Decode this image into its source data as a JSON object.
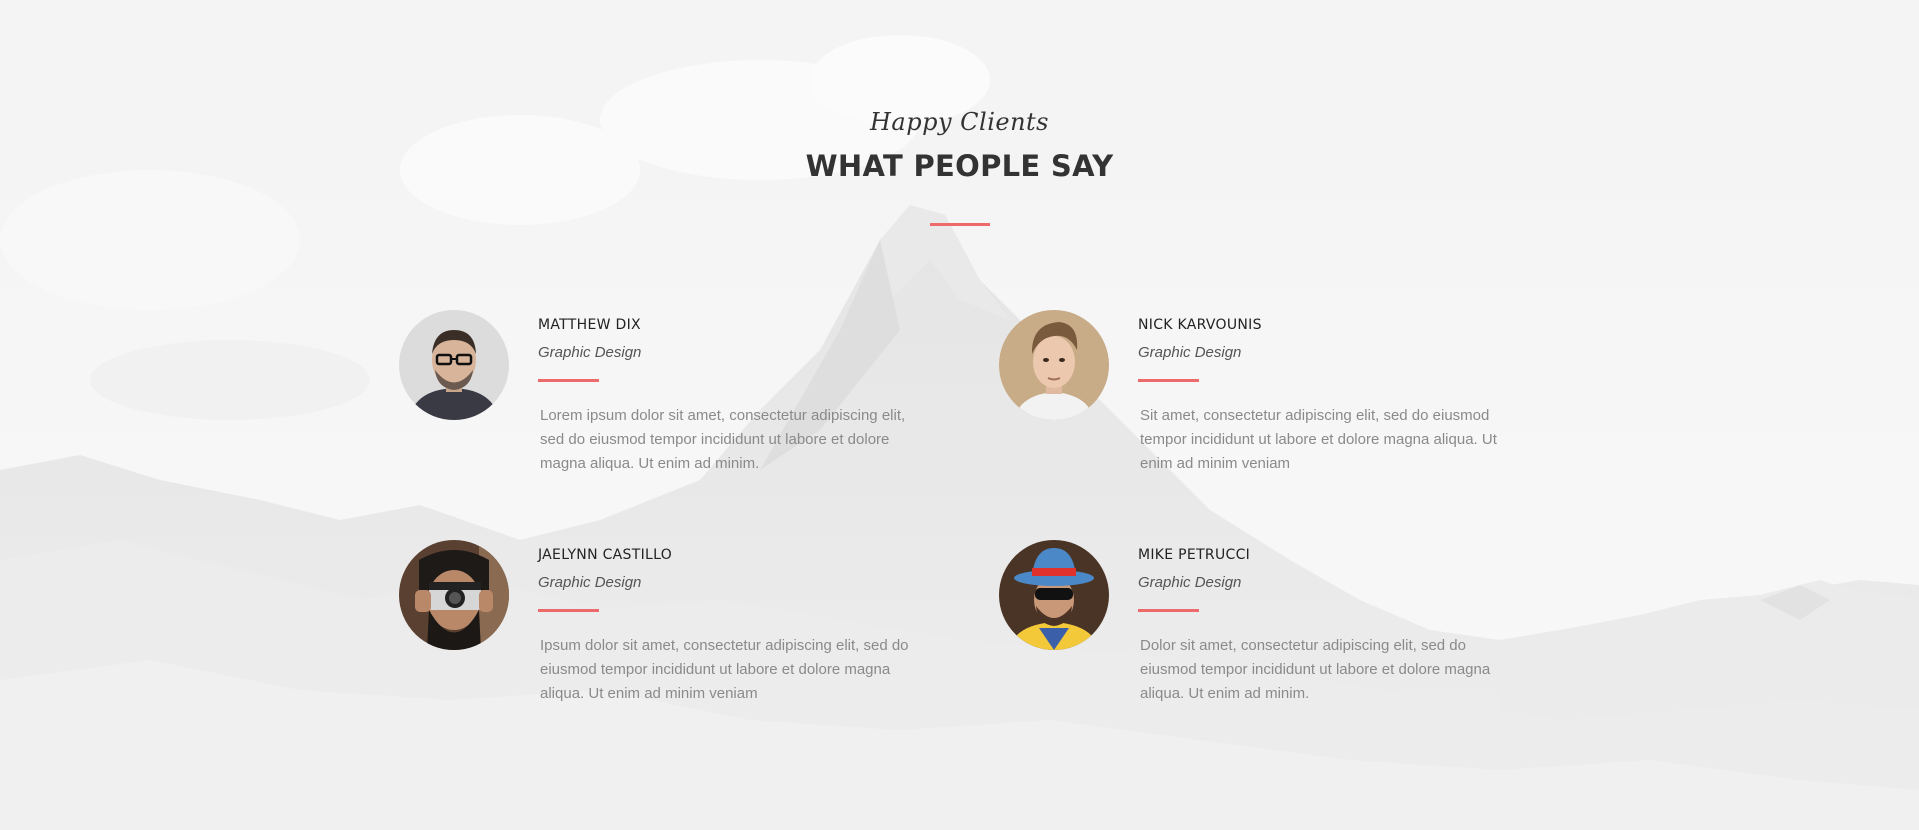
{
  "section": {
    "kicker": "Happy Clients",
    "title": "WHAT PEOPLE SAY"
  },
  "testimonials": [
    {
      "name": "MATTHEW DIX",
      "role": "Graphic Design",
      "text": "Lorem ipsum dolor sit amet, consectetur adipiscing elit, sed do eiusmod tempor incididunt ut labore et dolore magna aliqua. Ut enim ad minim."
    },
    {
      "name": "NICK KARVOUNIS",
      "role": "Graphic Design",
      "text": "Sit amet, consectetur adipiscing elit, sed do eiusmod tempor incididunt ut labore et dolore magna aliqua. Ut enim ad minim veniam"
    },
    {
      "name": "JAELYNN CASTILLO",
      "role": "Graphic Design",
      "text": "Ipsum dolor sit amet, consectetur adipiscing elit, sed do eiusmod tempor incididunt ut labore et dolore magna aliqua. Ut enim ad minim veniam"
    },
    {
      "name": "MIKE PETRUCCI",
      "role": "Graphic Design",
      "text": "Dolor sit amet, consectetur adipiscing elit, sed do eiusmod tempor incididunt ut labore et dolore magna aliqua. Ut enim ad minim."
    }
  ],
  "colors": {
    "accent": "#ec6a6a",
    "heading": "#333333",
    "body_text": "#8a8a8a"
  }
}
